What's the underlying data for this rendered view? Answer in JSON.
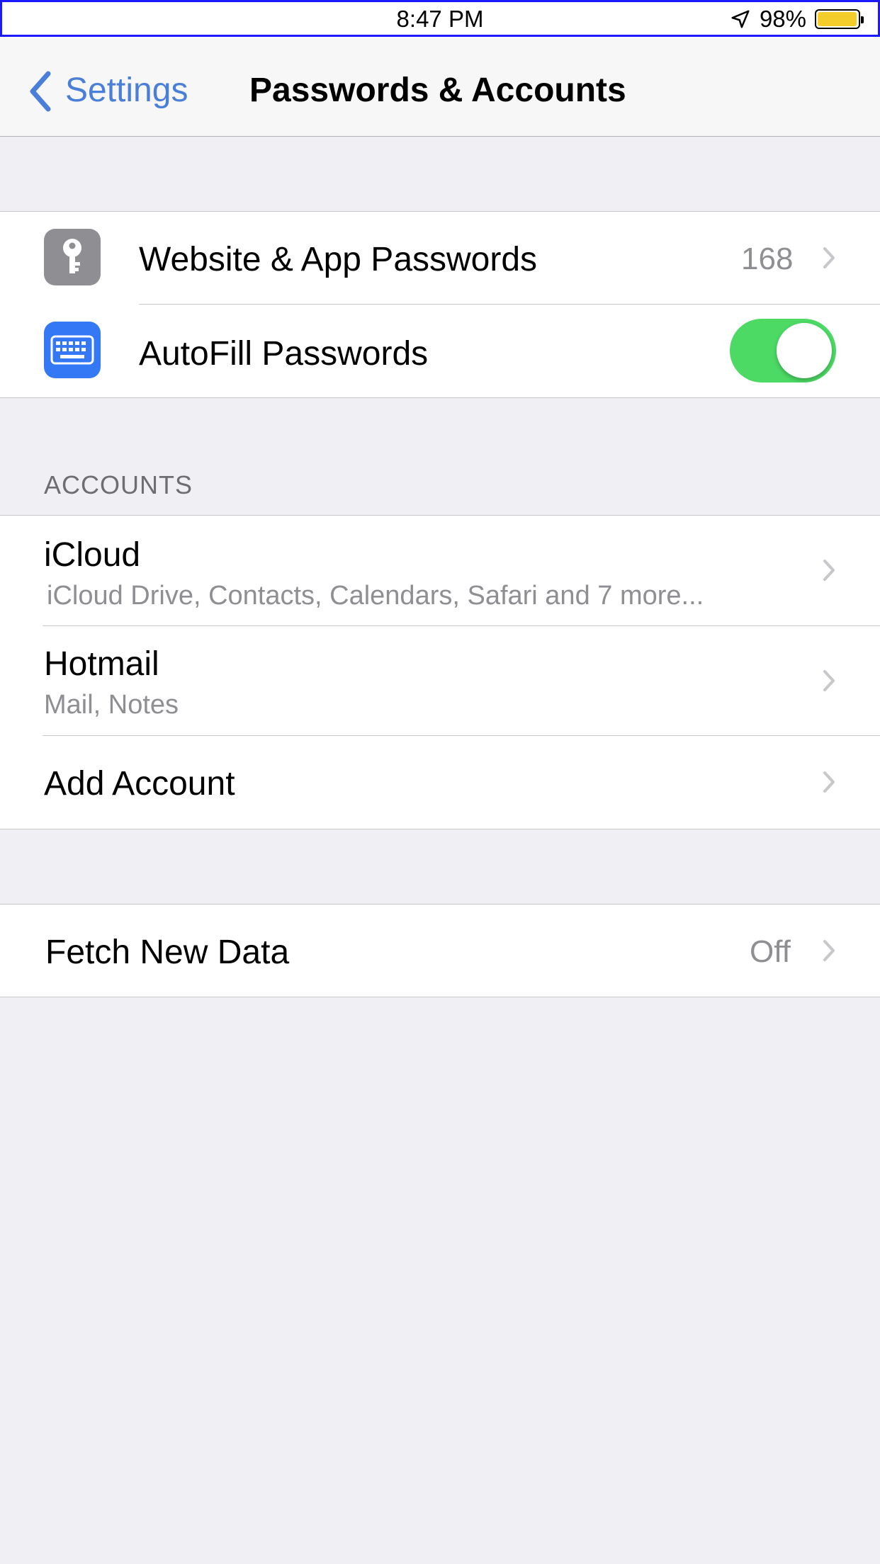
{
  "status_bar": {
    "time": "8:47 PM",
    "battery_percent": "98%",
    "battery_level": 0.98,
    "location_icon": "location-arrow-icon",
    "battery_color": "#f5cd2a"
  },
  "nav": {
    "back_label": "Settings",
    "title": "Passwords & Accounts",
    "accent": "#4a7fd9"
  },
  "passwords": {
    "website_passwords": {
      "label": "Website & App Passwords",
      "count": "168",
      "icon": "key-icon"
    },
    "autofill": {
      "label": "AutoFill Passwords",
      "enabled": true,
      "icon": "keyboard-icon"
    }
  },
  "accounts": {
    "header": "ACCOUNTS",
    "items": [
      {
        "name": "iCloud",
        "detail": "iCloud Drive, Contacts, Calendars, Safari and 7 more..."
      },
      {
        "name": "Hotmail",
        "detail": "Mail, Notes"
      }
    ],
    "add_label": "Add Account"
  },
  "fetch": {
    "label": "Fetch New Data",
    "value": "Off"
  },
  "colors": {
    "switch_on": "#4cd964",
    "secondary_text": "#8e8e93",
    "background": "#efeff4"
  }
}
